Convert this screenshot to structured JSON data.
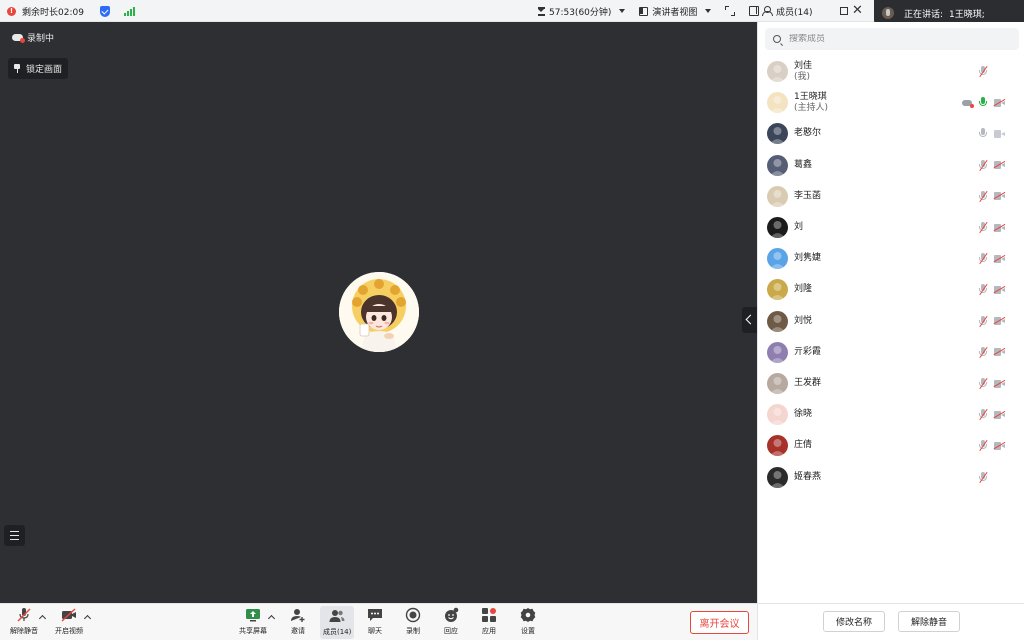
{
  "topbar": {
    "remaining_time": "剩余时长02:09",
    "timer": "57:53(60分钟)",
    "view_mode": "演讲者视图",
    "members_title": "成员(14)"
  },
  "toast": {
    "label": "正在讲话:",
    "speaker": "1王晓琪;"
  },
  "stage": {
    "recording_label": "录制中",
    "lock_label": "锁定画面"
  },
  "toolbar": {
    "unmute": "解除静音",
    "start_video": "开启视频",
    "share_screen": "共享屏幕",
    "invite": "邀请",
    "members": "成员(14)",
    "chat": "聊天",
    "record": "录制",
    "react": "回应",
    "apps": "应用",
    "settings": "设置",
    "leave": "离开会议"
  },
  "panel": {
    "search_placeholder": "搜索成员",
    "rename": "修改名称",
    "unmute": "解除静音",
    "members": [
      {
        "name": "刘佳",
        "sub": "(我)",
        "mic": "muted",
        "cam": "none",
        "avatar_color": "#d9cfc4"
      },
      {
        "name": "1王晓琪",
        "sub": "(主持人)",
        "mic": "on",
        "cam": "off",
        "cloud": true,
        "avatar_color": "#f3e3c0"
      },
      {
        "name": "老憨尔",
        "sub": "",
        "mic": "idle",
        "cam": "idle",
        "avatar_color": "#3b4659"
      },
      {
        "name": "葛鑫",
        "sub": "",
        "mic": "muted",
        "cam": "off",
        "avatar_color": "#565e75"
      },
      {
        "name": "李玉菡",
        "sub": "",
        "mic": "muted",
        "cam": "off",
        "avatar_color": "#d8cbb2"
      },
      {
        "name": "刘",
        "sub": "",
        "mic": "muted",
        "cam": "off",
        "avatar_color": "#1c1c1c"
      },
      {
        "name": "刘隽婕",
        "sub": "",
        "mic": "muted",
        "cam": "off",
        "avatar_color": "#5aa3e6"
      },
      {
        "name": "刘隆",
        "sub": "",
        "mic": "muted",
        "cam": "off",
        "avatar_color": "#c9a94a"
      },
      {
        "name": "刘悦",
        "sub": "",
        "mic": "muted",
        "cam": "off",
        "avatar_color": "#6e5a45"
      },
      {
        "name": "亓彩霞",
        "sub": "",
        "mic": "muted",
        "cam": "off",
        "avatar_color": "#8f7fb0"
      },
      {
        "name": "王发群",
        "sub": "",
        "mic": "muted",
        "cam": "off",
        "avatar_color": "#b7a8a0"
      },
      {
        "name": "徐晓",
        "sub": "",
        "mic": "muted",
        "cam": "off",
        "avatar_color": "#f4d5cf"
      },
      {
        "name": "庄倩",
        "sub": "",
        "mic": "muted",
        "cam": "off",
        "avatar_color": "#a7322a"
      },
      {
        "name": "姬春燕",
        "sub": "",
        "mic": "muted",
        "cam": "none",
        "avatar_color": "#2b2b2b"
      }
    ]
  }
}
